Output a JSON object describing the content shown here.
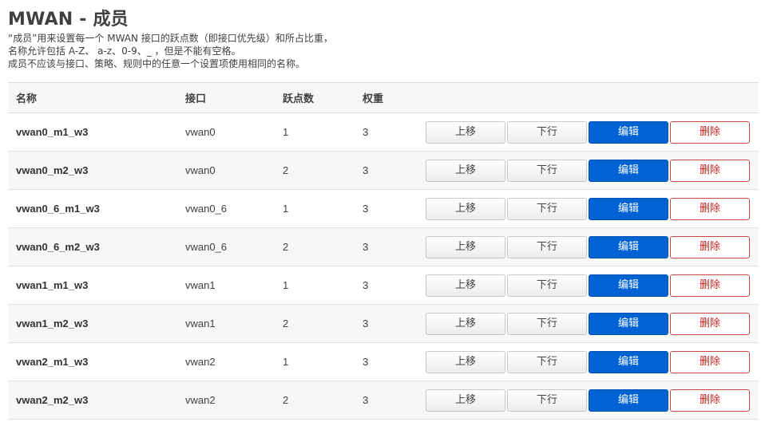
{
  "page": {
    "title": "MWAN - 成员",
    "description": [
      "“成员”用来设置每一个 MWAN 接口的跃点数（即接口优先级）和所占比重，",
      "名称允许包括 A-Z、 a-z、0-9、_ ，但是不能有空格。",
      "成员不应该与接口、策略、规则中的任意一个设置项使用相同的名称。"
    ]
  },
  "table": {
    "headers": [
      "名称",
      "接口",
      "跃点数",
      "权重"
    ],
    "rows": [
      {
        "name": "vwan0_m1_w3",
        "interface": "vwan0",
        "metric": "1",
        "weight": "3"
      },
      {
        "name": "vwan0_m2_w3",
        "interface": "vwan0",
        "metric": "2",
        "weight": "3"
      },
      {
        "name": "vwan0_6_m1_w3",
        "interface": "vwan0_6",
        "metric": "1",
        "weight": "3"
      },
      {
        "name": "vwan0_6_m2_w3",
        "interface": "vwan0_6",
        "metric": "2",
        "weight": "3"
      },
      {
        "name": "vwan1_m1_w3",
        "interface": "vwan1",
        "metric": "1",
        "weight": "3"
      },
      {
        "name": "vwan1_m2_w3",
        "interface": "vwan1",
        "metric": "2",
        "weight": "3"
      },
      {
        "name": "vwan2_m1_w3",
        "interface": "vwan2",
        "metric": "1",
        "weight": "3"
      },
      {
        "name": "vwan2_m2_w3",
        "interface": "vwan2",
        "metric": "2",
        "weight": "3"
      }
    ],
    "buttons": {
      "up": "上移",
      "down": "下行",
      "edit": "编辑",
      "delete": "删除"
    }
  },
  "colors": {
    "edit_button": "#0062d3",
    "delete_border": "#cc4444",
    "row_alt": "#f7f7f7"
  }
}
